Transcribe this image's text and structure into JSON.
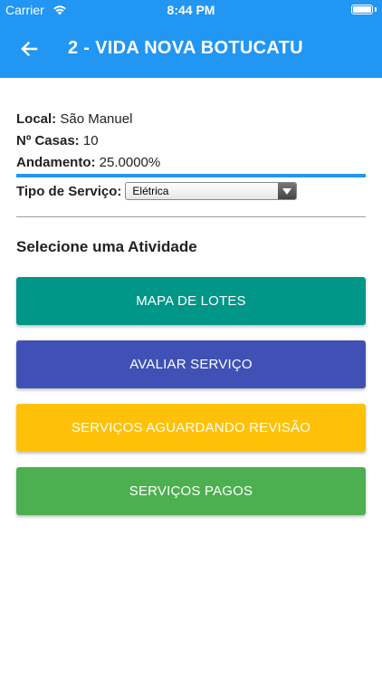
{
  "status_bar": {
    "carrier": "Carrier",
    "time": "8:44 PM"
  },
  "app_bar": {
    "title": "2 - VIDA NOVA BOTUCATU",
    "back_icon": "arrow-left-icon",
    "color": "#2196f3"
  },
  "info": {
    "local_label": "Local:",
    "local_value": " São Manuel",
    "casas_label": "Nº Casas:",
    "casas_value": " 10",
    "andamento_label": "Andamento:",
    "andamento_value": " 25.0000%",
    "progress_fraction": 1.0
  },
  "service_type": {
    "label": "Tipo de Serviço:",
    "selected": "Elétrica"
  },
  "section_title": "Selecione uma Atividade",
  "actions": [
    {
      "label": "MAPA DE LOTES",
      "color": "#009688"
    },
    {
      "label": "AVALIAR SERVIÇO",
      "color": "#3f51b5"
    },
    {
      "label": "SERVIÇOS AGUARDANDO REVISÃO",
      "color": "#ffc107"
    },
    {
      "label": "SERVIÇOS PAGOS",
      "color": "#4caf50"
    }
  ]
}
